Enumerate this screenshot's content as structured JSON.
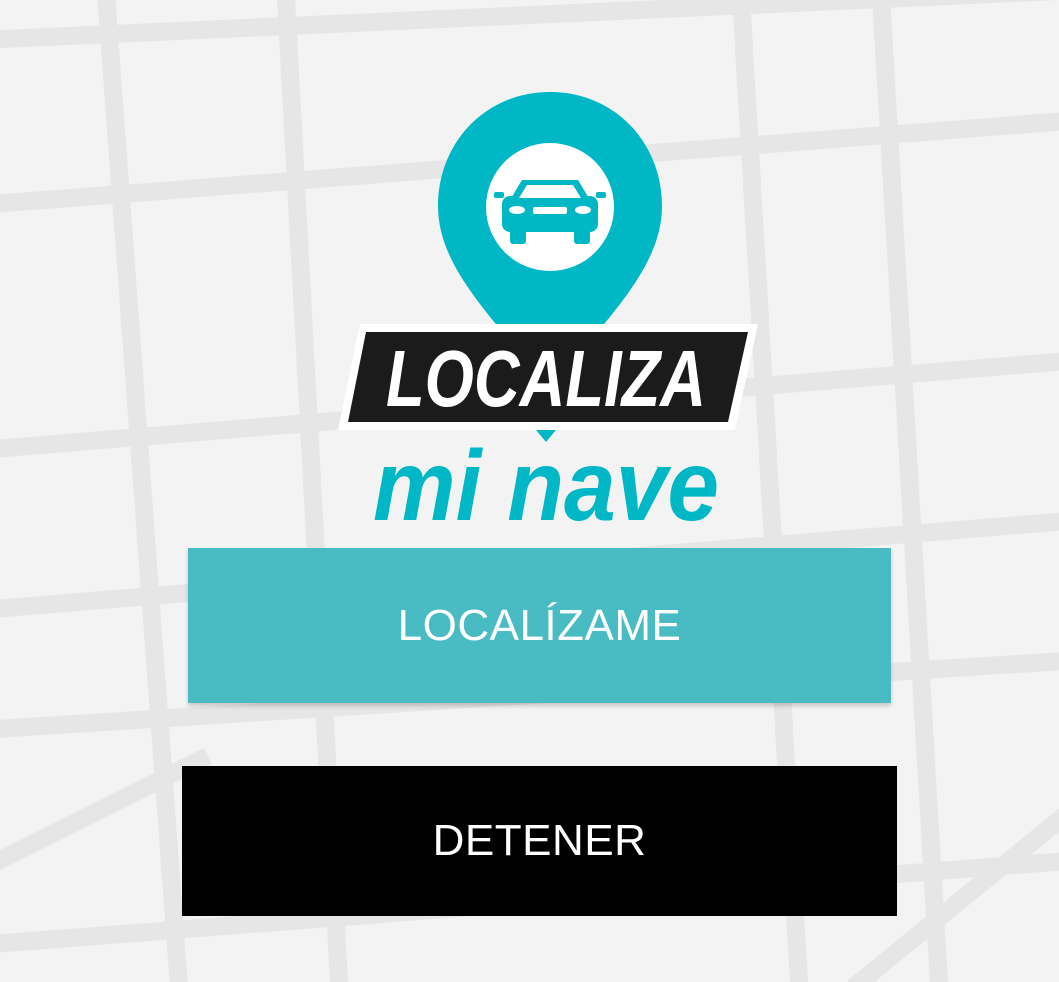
{
  "colors": {
    "background": "#f3f3f3",
    "map_streets": "#e6e6e6",
    "brand_teal": "#00b8c5",
    "locate_button": "#49bcc3",
    "stop_button": "#000000",
    "button_text": "#ffffff"
  },
  "logo": {
    "line1": "LOCALIZA",
    "line2": "mi nave",
    "icon": "car-location-pin-icon"
  },
  "buttons": {
    "locate_label": "LOCALÍZAME",
    "stop_label": "DETENER"
  }
}
